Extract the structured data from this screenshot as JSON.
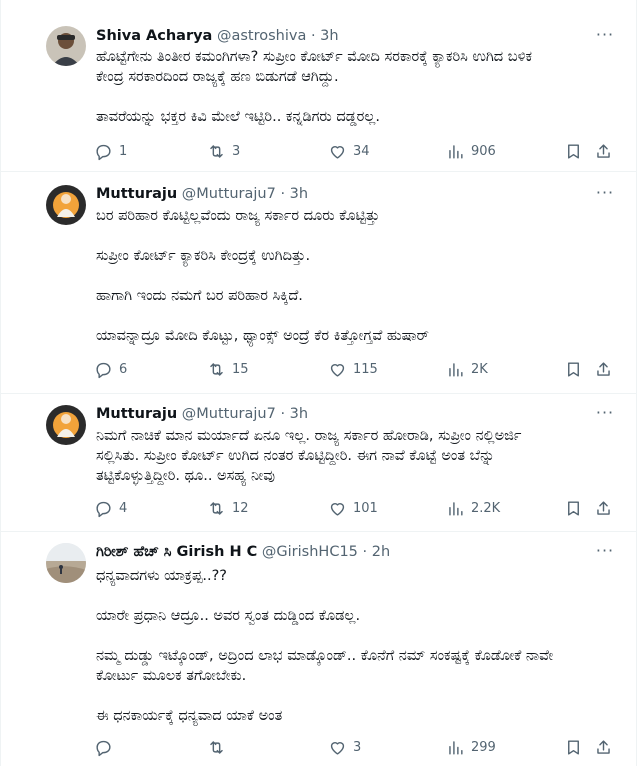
{
  "tweets": [
    {
      "name": "Shiva Acharya",
      "handle": "@astroshiva",
      "time": "· 3h",
      "lines": [
        "ಹೊಟ್ಟೆಗೇನು ತಿಂತೀರ ಕಮಂಗಿಗಳಾ? ಸುಪ್ರೀಂ ಕೋರ್ಟ್ ಮೋದಿ ಸರಕಾರಕ್ಕೆ ಕ್ಯಾಕರಿಸಿ ಉಗಿದ ಬಳಿಕ",
        "ಕೇಂದ್ರ ಸರಕಾರದಿಂದ ರಾಜ್ಯಕ್ಕೆ ಹಣ ಬಿಡುಗಡೆ ಆಗಿದ್ದು.",
        "",
        "ತಾವರೆಯನ್ನು ಭಕ್ತರ ಕಿವಿ ಮೇಲೆ ಇಟ್ಟಿರಿ.. ಕನ್ನಡಿಗರು ದಡ್ಡರಲ್ಲ."
      ],
      "replies": "1",
      "retweets": "3",
      "likes": "34",
      "views": "906"
    },
    {
      "name": "Mutturaju",
      "handle": "@Mutturaju7",
      "time": "· 3h",
      "lines": [
        "ಬರ ಪರಿಹಾರ ಕೊಟ್ಟಿಲ್ಲವೆಂದು ರಾಜ್ಯ ಸರ್ಕಾರ ದೂರು ಕೊಟ್ಟಿತ್ತು",
        "",
        "ಸುಪ್ರೀಂ ಕೋರ್ಟ್ ಕ್ಯಾಕರಿಸಿ ಕೇಂದ್ರಕ್ಕೆ ಉಗಿದಿತ್ತು.",
        "",
        "ಹಾಗಾಗಿ ಇಂದು ನಮಗೆ ಬರ ಪರಿಹಾರ ಸಿಕ್ಕಿದೆ.",
        "",
        "ಯಾವನ್ನಾದ್ರೂ ಮೋದಿ ಕೊಟ್ಟು, ಥ್ಯಾಂಕ್ಸ್ ಅಂದ್ರೆ ಕೆರ ಕಿತ್ತೋಗ್ತವೆ ಹುಷಾರ್"
      ],
      "replies": "6",
      "retweets": "15",
      "likes": "115",
      "views": "2K"
    },
    {
      "name": "Mutturaju",
      "handle": "@Mutturaju7",
      "time": "· 3h",
      "lines": [
        "ನಿಮಗೆ ನಾಚಿಕೆ ಮಾನ ಮರ್ಯಾದೆ ಏನೂ ಇಲ್ಲ. ರಾಜ್ಯ ಸರ್ಕಾರ ಹೋರಾಡಿ, ಸುಪ್ರೀಂ ನಲ್ಲಿಅರ್ಜಿ",
        "ಸಲ್ಲಿಸಿತು. ಸುಪ್ರೀಂ ಕೋರ್ಟ್ ಉಗಿದ ನಂತರ ಕೊಟ್ಟಿದ್ದೀರಿ. ಈಗ ನಾವೆ ಕೊಟ್ಟೆ ಅಂತ ಬೆನ್ನು",
        "ತಟ್ಟಿಕೊಳ್ಳುತ್ತಿದ್ದೀರಿ. ಥೂ.. ಅಸಹ್ಯ ನೀವು"
      ],
      "replies": "4",
      "retweets": "12",
      "likes": "101",
      "views": "2.2K"
    },
    {
      "name": "ಗಿರೀಶ್ ಹೆಚ್ ಸಿ Girish H C",
      "handle": "@GirishHC15",
      "time": "· 2h",
      "lines": [
        "ಧನ್ಯವಾದಗಳು ಯಾಕ್ರಪ್ಪ..??",
        "",
        "ಯಾರೇ ಪ್ರಧಾನಿ ಆದ್ರೂ.. ಅವರ ಸ್ವಂತ ದುಡ್ಡಿಂದ ಕೊಡಲ್ಲ.",
        "",
        "ನಮ್ಮ ದುಡ್ಡು ಇಟ್ಕೊಂಡ್, ಅದ್ರಿಂದ ಲಾಭ ಮಾಡ್ಕೊಂಡ್.. ಕೊನೆಗೆ ನಮ್ ಸಂಕಷ್ಟಕ್ಕೆ ಕೊಡೋಕೆ ನಾವೇ",
        "ಕೋರ್ಟು ಮೂಲಕ ತಗೋಬೇಕು.",
        "",
        "ಈ ಧನಕಾರ್ಯಕ್ಕೆ ಧನ್ಯವಾದ ಯಾಕೆ ಅಂತ"
      ],
      "replies": "",
      "retweets": "",
      "likes": "3",
      "views": "299"
    }
  ],
  "icons": {
    "reply": "reply-icon",
    "retweet": "retweet-icon",
    "like": "heart-icon",
    "views": "views-icon",
    "bookmark": "bookmark-icon",
    "share": "share-icon",
    "more": "more-icon"
  },
  "colors": {
    "text": "#0f1419",
    "secondary": "#536471",
    "divider": "#eff3f4"
  }
}
